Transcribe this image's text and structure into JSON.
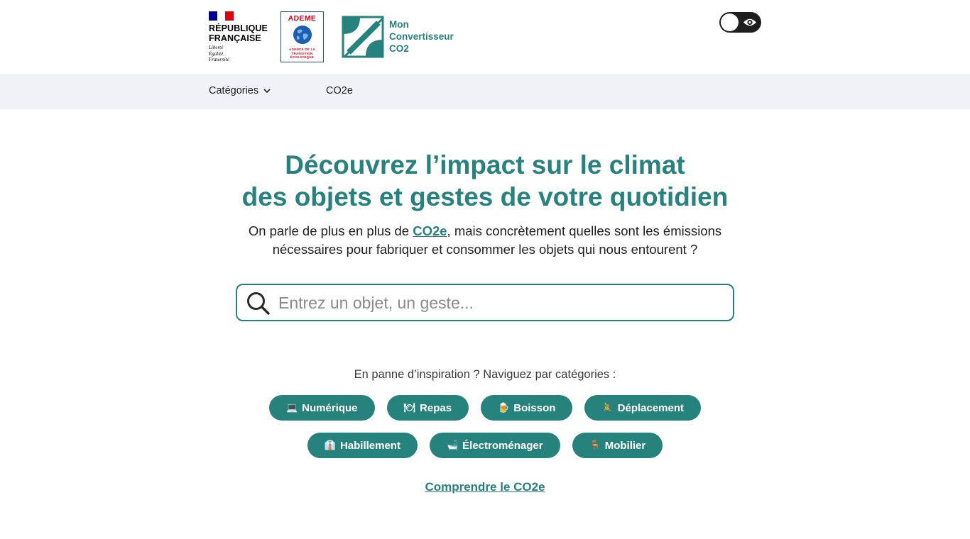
{
  "header": {
    "rf_name_line1": "RÉPUBLIQUE",
    "rf_name_line2": "FRANÇAISE",
    "rf_motto_line1": "Liberté",
    "rf_motto_line2": "Égalité",
    "rf_motto_line3": "Fraternité",
    "ademe_title": "ADEME",
    "ademe_sub_line1": "AGENCE DE LA",
    "ademe_sub_line2": "TRANSITION",
    "ademe_sub_line3": "ÉCOLOGIQUE",
    "app_name_line1": "Mon",
    "app_name_line2": "Convertisseur",
    "app_name_line3": "CO2",
    "toggle_icon": "eye-icon"
  },
  "nav": {
    "categories_label": "Catégories",
    "co2e_label": "CO2e"
  },
  "hero": {
    "title_line1": "Découvrez l’impact sur le climat",
    "title_line2": "des objets et gestes de votre quotidien",
    "text_before": "On parle de plus en plus de ",
    "text_link": "CO2e",
    "text_after_line1": ", mais concrètement quelles sont les émissions",
    "text_line2": "nécessaires pour fabriquer et consommer les objets qui nous entourent ?"
  },
  "search": {
    "placeholder": "Entrez un objet, un geste...",
    "value": ""
  },
  "inspiration": {
    "label": "En panne d’inspiration ? Naviguez par catégories :"
  },
  "categories_row1": [
    {
      "emoji": "💻",
      "label": "Numérique"
    },
    {
      "emoji": "🍽",
      "label": "Repas"
    },
    {
      "emoji": "🍺",
      "label": "Boisson"
    },
    {
      "emoji": "🚴",
      "label": "Déplacement"
    }
  ],
  "categories_row2": [
    {
      "emoji": "👔",
      "label": "Habillement"
    },
    {
      "emoji": "🛁",
      "label": "Électroménager"
    },
    {
      "emoji": "🪑",
      "label": "Mobilier"
    }
  ],
  "footer_link": {
    "label": "Comprendre le CO2e"
  },
  "colors": {
    "brand_green": "#26827c",
    "nav_bg": "#eff3f7",
    "text": "#1e1e1e",
    "rf_blue": "#000091",
    "rf_red": "#e1000f"
  }
}
